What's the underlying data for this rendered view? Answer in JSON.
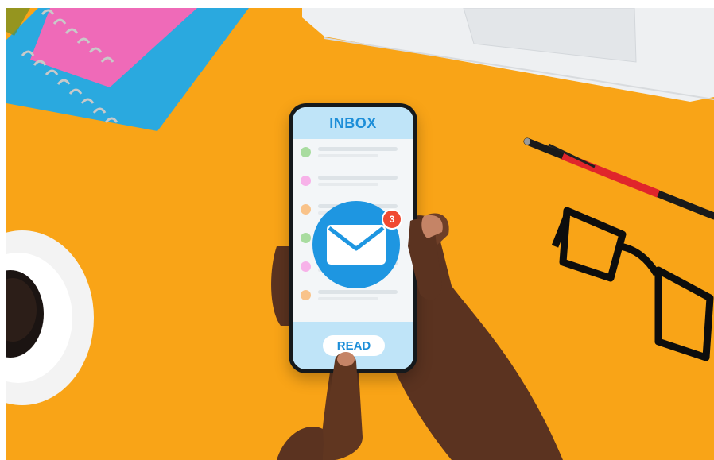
{
  "scene": {
    "background_color": "#f9a417",
    "objects": [
      "notebooks-icon",
      "laptop-icon",
      "coffee-cup-icon",
      "pen-icon",
      "glasses-icon",
      "hand-icon"
    ]
  },
  "phone": {
    "title": "INBOX",
    "notification_count": "3",
    "button_label": "READ",
    "accent_color": "#1d8ed8",
    "badge_color": "#f04a32",
    "list_dot_colors": [
      "#a8dca0",
      "#f7b2e9",
      "#f9c38a",
      "#a8dca0",
      "#f7b2e9",
      "#f9c38a"
    ]
  }
}
